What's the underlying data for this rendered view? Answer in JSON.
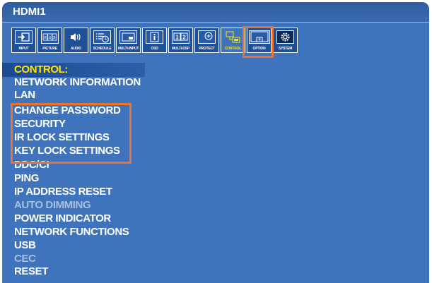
{
  "title": "HDMI1",
  "tabs": [
    {
      "label": "INPUT",
      "icon": "input-icon"
    },
    {
      "label": "PICTURE",
      "icon": "picture-rgb-icon"
    },
    {
      "label": "AUDIO",
      "icon": "speaker-icon"
    },
    {
      "label": "SCHEDULE",
      "icon": "schedule-icon"
    },
    {
      "label": "MULTI-INPUT",
      "icon": "multi-input-icon"
    },
    {
      "label": "OSD",
      "icon": "info-icon"
    },
    {
      "label": "MULTI-DSP",
      "icon": "multi-display-icon"
    },
    {
      "label": "PROTECT",
      "icon": "protect-icon"
    },
    {
      "label": "CONTROL",
      "icon": "control-icon",
      "active": true
    },
    {
      "label": "OPTION",
      "icon": "option-icon"
    },
    {
      "label": "SYSTEM",
      "icon": "system-gear-icon"
    }
  ],
  "menu": {
    "heading": "CONTROL:",
    "items": [
      {
        "label": "NETWORK INFORMATION",
        "enabled": true
      },
      {
        "label": "LAN",
        "enabled": true
      },
      {
        "label": "CHANGE PASSWORD",
        "enabled": true
      },
      {
        "label": "SECURITY",
        "enabled": true
      },
      {
        "label": "IR LOCK SETTINGS",
        "enabled": true
      },
      {
        "label": "KEY LOCK SETTINGS",
        "enabled": true
      },
      {
        "label": "DDC/CI",
        "enabled": true
      },
      {
        "label": "PING",
        "enabled": true
      },
      {
        "label": "IP ADDRESS RESET",
        "enabled": true
      },
      {
        "label": "AUTO DIMMING",
        "enabled": false
      },
      {
        "label": "POWER INDICATOR",
        "enabled": true
      },
      {
        "label": "NETWORK FUNCTIONS",
        "enabled": true
      },
      {
        "label": "USB",
        "enabled": true
      },
      {
        "label": "CEC",
        "enabled": false
      },
      {
        "label": "RESET",
        "enabled": true
      }
    ]
  },
  "colors": {
    "background": "#3f74bc",
    "highlight": "#e8742d",
    "accent": "#ffe400",
    "disabled": "#a8bfe0"
  }
}
